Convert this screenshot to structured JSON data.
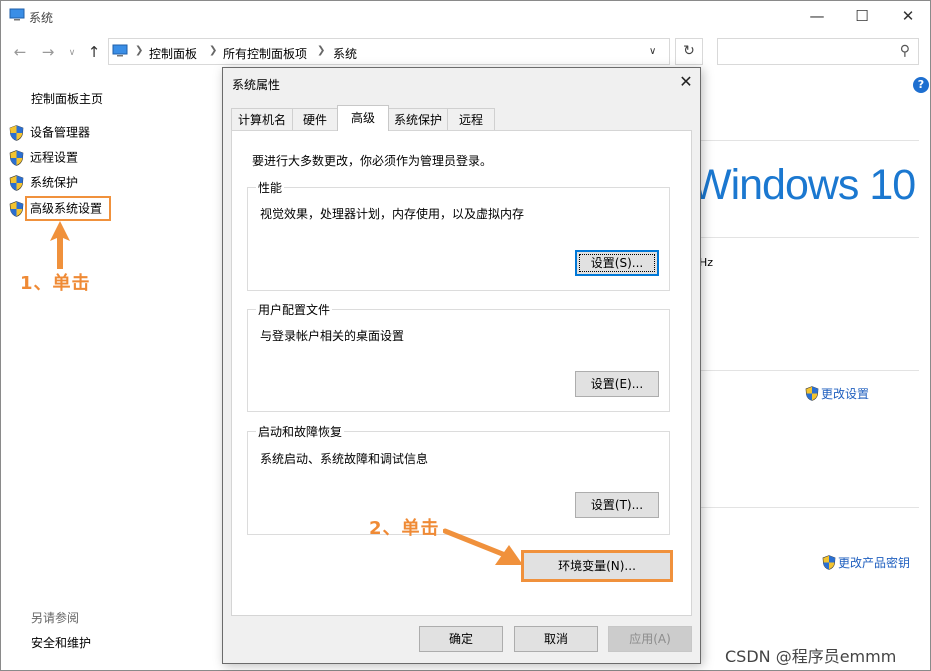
{
  "window": {
    "title": "系统",
    "address": {
      "crumbs": [
        "控制面板",
        "所有控制面板项",
        "系统"
      ]
    }
  },
  "sidebar": {
    "home": "控制面板主页",
    "items": [
      {
        "label": "设备管理器"
      },
      {
        "label": "远程设置"
      },
      {
        "label": "系统保护"
      },
      {
        "label": "高级系统设置"
      }
    ],
    "see_also_title": "另请参阅",
    "see_also_items": [
      "安全和维护"
    ]
  },
  "main": {
    "windows_logo_text": "Windows 10",
    "partial_text": "Hz",
    "change_settings": "更改设置",
    "change_product_key": "更改产品密钥"
  },
  "annotations": {
    "step1": "1、单击",
    "step2": "2、单击",
    "color": "#ef8a35"
  },
  "dialog": {
    "title": "系统属性",
    "tabs": [
      "计算机名",
      "硬件",
      "高级",
      "系统保护",
      "远程"
    ],
    "active_tab": "高级",
    "intro": "要进行大多数更改，你必须作为管理员登录。",
    "performance": {
      "label": "性能",
      "desc": "视觉效果，处理器计划，内存使用，以及虚拟内存",
      "button": "设置(S)..."
    },
    "profile": {
      "label": "用户配置文件",
      "desc": "与登录帐户相关的桌面设置",
      "button": "设置(E)..."
    },
    "startup": {
      "label": "启动和故障恢复",
      "desc": "系统启动、系统故障和调试信息",
      "button": "设置(T)..."
    },
    "env_button": "环境变量(N)...",
    "ok": "确定",
    "cancel": "取消",
    "apply": "应用(A)"
  },
  "watermark": "CSDN @程序员emmm",
  "colors": {
    "accent": "#0078d7",
    "link": "#1f5fbf",
    "windows_blue": "#1b78d0"
  }
}
